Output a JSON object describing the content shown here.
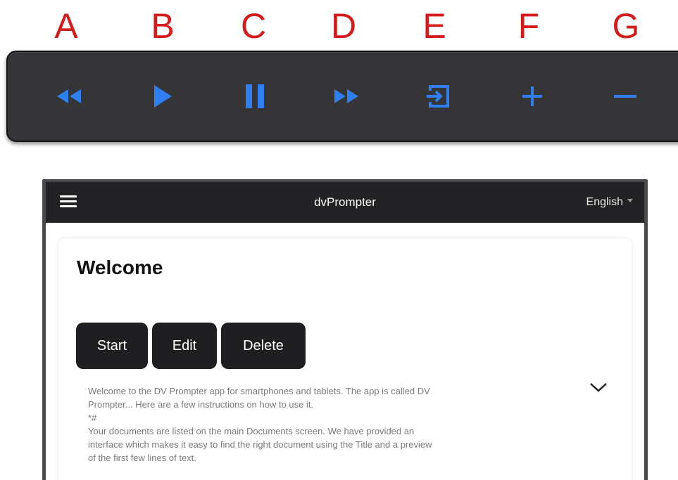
{
  "letters": [
    "A",
    "B",
    "C",
    "D",
    "E",
    "F",
    "G"
  ],
  "controls": [
    {
      "letter": "A",
      "icon": "rewind-icon",
      "action": "rewind"
    },
    {
      "letter": "B",
      "icon": "play-icon",
      "action": "play"
    },
    {
      "letter": "C",
      "icon": "pause-icon",
      "action": "pause"
    },
    {
      "letter": "D",
      "icon": "fast-forward-icon",
      "action": "fast-forward"
    },
    {
      "letter": "E",
      "icon": "enter-icon",
      "action": "enter"
    },
    {
      "letter": "F",
      "icon": "plus-icon",
      "action": "increase"
    },
    {
      "letter": "G",
      "icon": "minus-icon",
      "action": "decrease"
    }
  ],
  "colors": {
    "letter": "#d41c1c",
    "icon": "#2f7ff0",
    "bar": "#353538",
    "header": "#222224",
    "button": "#1f1f21"
  },
  "app": {
    "title": "dvPrompter",
    "language": "English",
    "menu_icon": "hamburger-icon"
  },
  "document": {
    "title": "Welcome",
    "buttons": {
      "start": "Start",
      "edit": "Edit",
      "delete": "Delete"
    },
    "expand_icon": "chevron-down-icon",
    "preview": [
      "Welcome to the DV Prompter app for smartphones and tablets. The app is called DV",
      "Prompter... Here are a few instructions on how to use it.",
      "*#",
      "Your documents are listed on the main Documents screen. We have provided an",
      "interface which makes it easy to find the right document using the Title and a preview",
      "of the first few lines of text."
    ]
  }
}
